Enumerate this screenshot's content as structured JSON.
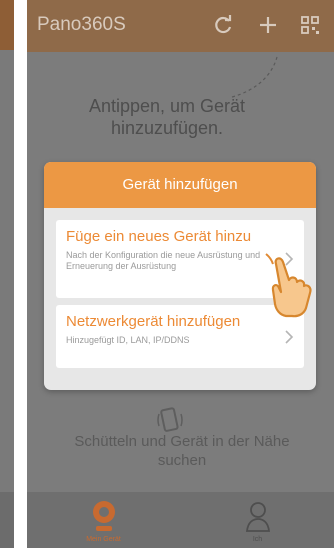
{
  "app": {
    "title": "Pano360S"
  },
  "toolbar": {
    "icons": [
      "refresh-icon",
      "add-icon",
      "qr-code-icon"
    ]
  },
  "hint": {
    "text": "Antippen, um Gerät hinzuzufügen."
  },
  "dialog": {
    "title": "Gerät hinzufügen",
    "options": [
      {
        "title": "Füge ein neues Gerät hinzu",
        "description": "Nach der Konfiguration die neue Ausrüstung und Erneuerung der Ausrüstung"
      },
      {
        "title": "Netzwerkgerät hinzufügen",
        "description": "Hinzugefügt ID, LAN, IP/DDNS"
      }
    ]
  },
  "shake": {
    "text": "Schütteln und Gerät in der Nähe suchen"
  },
  "tabs": [
    {
      "label": "Mein Gerät",
      "active": true
    },
    {
      "label": "Ich",
      "active": false
    }
  ],
  "colors": {
    "accent": "#ec9844",
    "appbar": "#8f6a49",
    "overlay": "#7c7c7c"
  }
}
